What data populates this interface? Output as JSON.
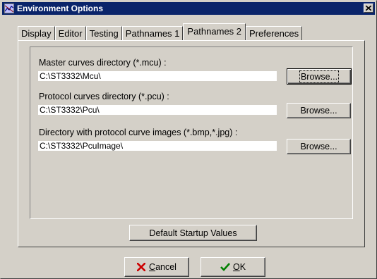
{
  "window": {
    "title": "Environment Options",
    "close_symbol": "x"
  },
  "tabs": [
    {
      "label": "Display",
      "active": false
    },
    {
      "label": "Editor",
      "active": false
    },
    {
      "label": "Testing",
      "active": false
    },
    {
      "label": "Pathnames 1",
      "active": false
    },
    {
      "label": "Pathnames 2",
      "active": true
    },
    {
      "label": "Preferences",
      "active": false
    }
  ],
  "fields": {
    "master": {
      "label": "Master curves directory (*.mcu) :",
      "value": "C:\\ST3332\\Mcu\\",
      "browse_label": "Browse..."
    },
    "protocol": {
      "label": "Protocol curves directory (*.pcu) :",
      "value": "C:\\ST3332\\Pcu\\",
      "browse_label": "Browse..."
    },
    "images": {
      "label": "Directory with protocol curve images (*.bmp,*.jpg) :",
      "value": "C:\\ST3332\\PcuImage\\",
      "browse_label": "Browse..."
    }
  },
  "buttons": {
    "default_startup": "Default Startup Values",
    "cancel": {
      "label_first": "C",
      "label_rest": "ancel",
      "icon": "red-x-icon"
    },
    "ok": {
      "label_first": "O",
      "label_rest": "K",
      "icon": "green-check-icon"
    }
  },
  "colors": {
    "titlebar": "#0a246a",
    "face": "#d4d0c8",
    "cancel_icon": "#cc0000",
    "ok_icon": "#008000"
  }
}
